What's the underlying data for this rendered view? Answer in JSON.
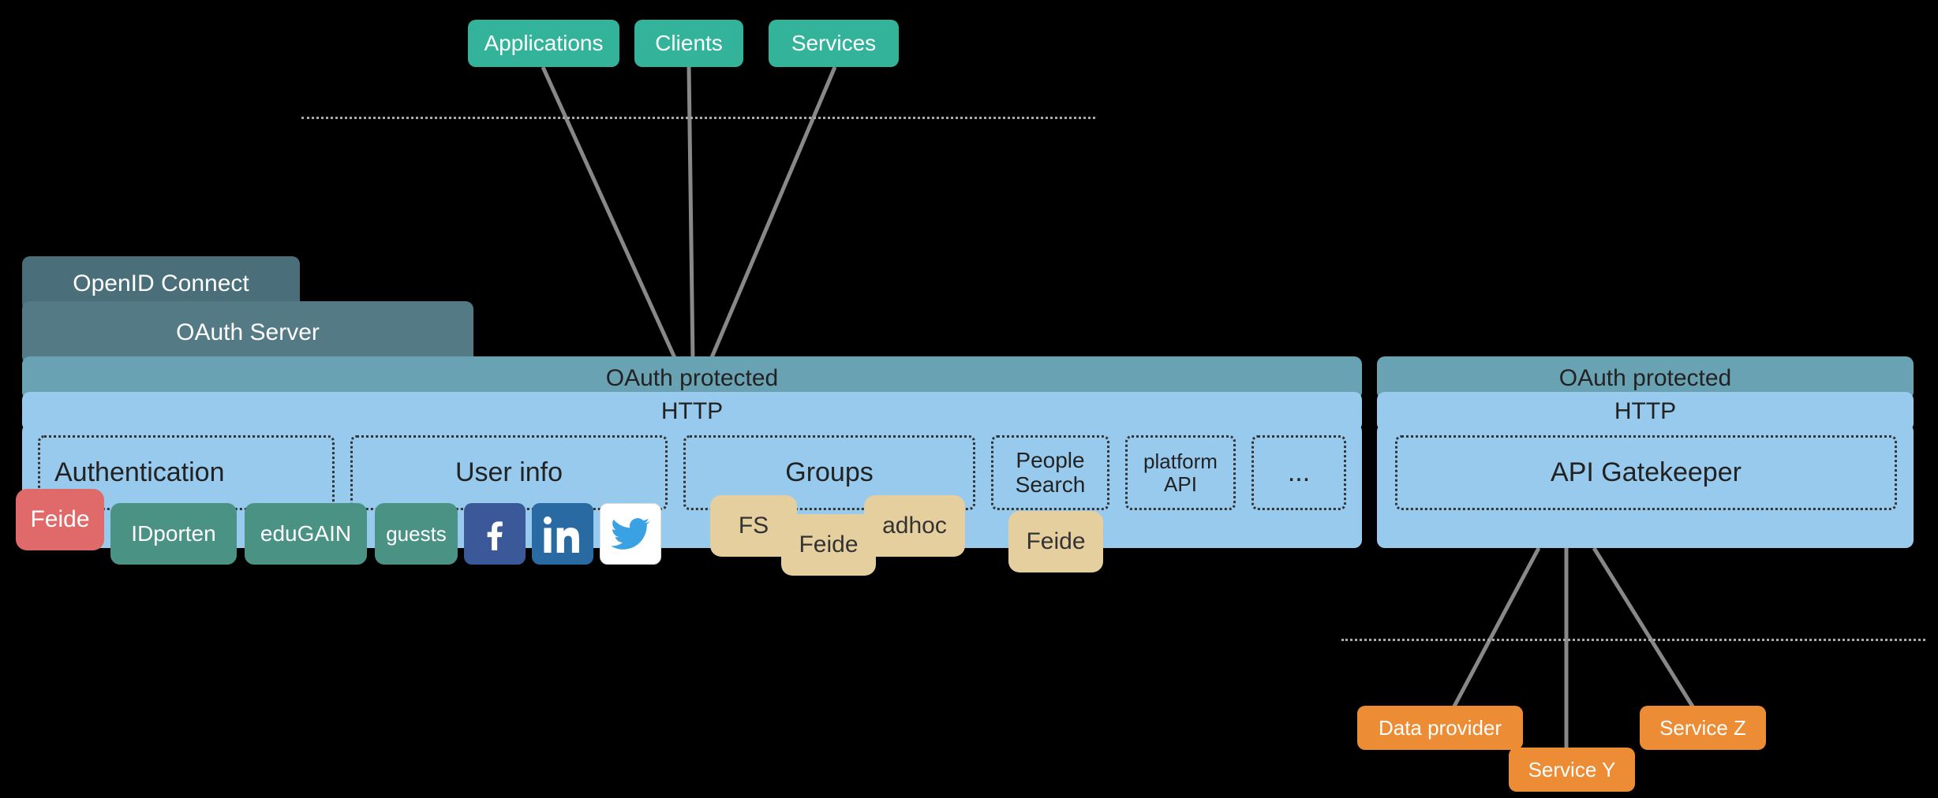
{
  "top_clients": {
    "applications": "Applications",
    "clients": "Clients",
    "services": "Services"
  },
  "tabs": {
    "openid_connect": "OpenID Connect",
    "oauth_server": "OAuth Server"
  },
  "main": {
    "oauth_protected": "OAuth protected",
    "http": "HTTP",
    "authentication": "Authentication",
    "user_info": "User info",
    "groups": "Groups",
    "people_search": "People\nSearch",
    "platform_api": "platform\nAPI",
    "ellipsis": "..."
  },
  "auth_providers": {
    "feide": "Feide",
    "idporten": "IDporten",
    "edugain": "eduGAIN",
    "guests": "guests"
  },
  "group_sources": {
    "fs": "FS",
    "feide": "Feide",
    "adhoc": "adhoc",
    "feide_people": "Feide"
  },
  "gateway": {
    "oauth_protected": "OAuth protected",
    "http": "HTTP",
    "api_gatekeeper": "API Gatekeeper"
  },
  "bottom_services": {
    "data_provider": "Data provider",
    "service_y": "Service Y",
    "service_z": "Service Z"
  }
}
